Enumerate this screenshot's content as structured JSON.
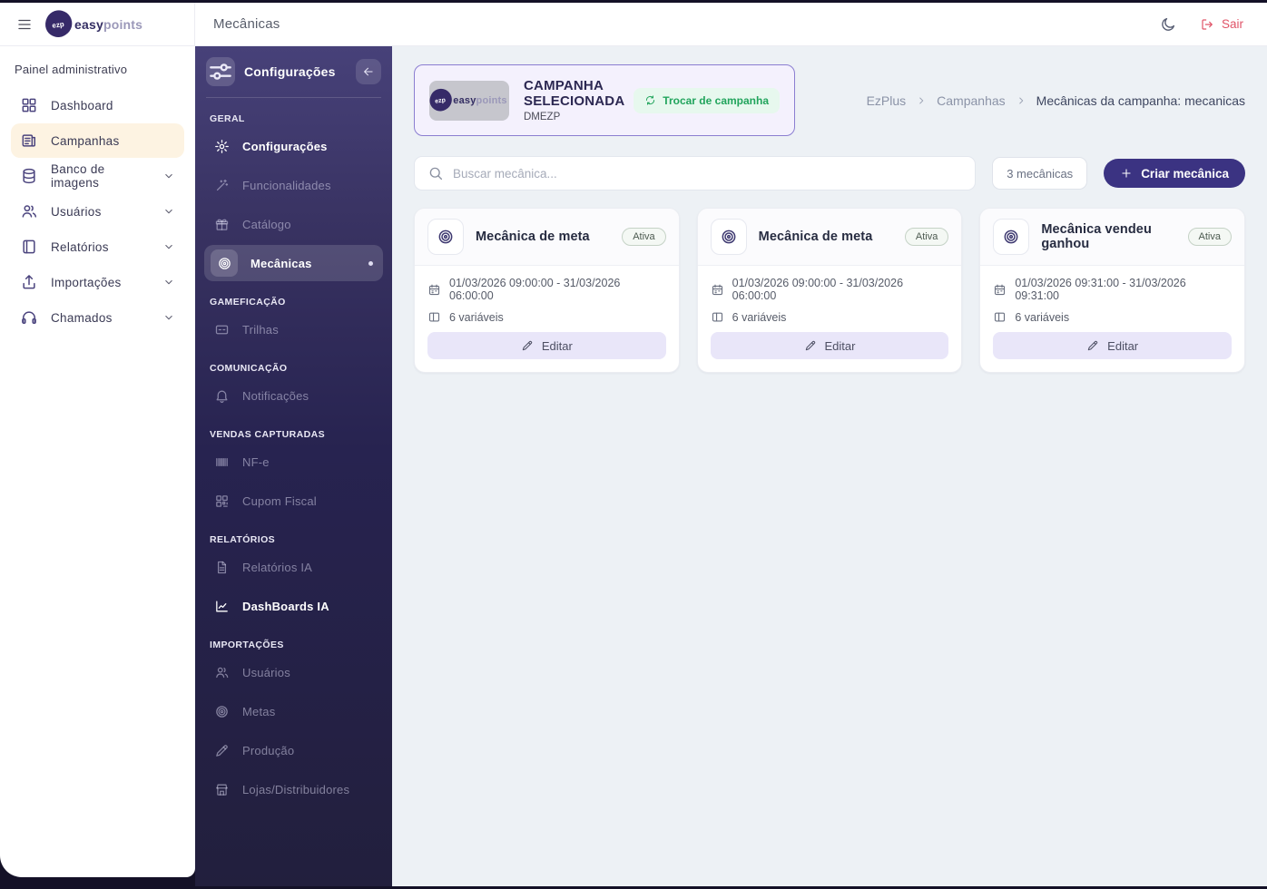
{
  "brand": {
    "mark": "ezp",
    "name_bold": "easy",
    "name_light": "points"
  },
  "topbar": {
    "title": "Mecânicas",
    "logout_label": "Sair",
    "icons": {
      "menu": "hamburger-icon",
      "theme": "moon-icon",
      "logout": "logout-icon"
    }
  },
  "outer_sidebar": {
    "heading": "Painel administrativo",
    "items": [
      {
        "label": "Dashboard",
        "icon": "grid",
        "active": false,
        "chevron": false
      },
      {
        "label": "Campanhas",
        "icon": "newspaper",
        "active": true,
        "chevron": false
      },
      {
        "label": "Banco de imagens",
        "icon": "database",
        "active": false,
        "chevron": true
      },
      {
        "label": "Usuários",
        "icon": "users",
        "active": false,
        "chevron": true
      },
      {
        "label": "Relatórios",
        "icon": "book",
        "active": false,
        "chevron": true
      },
      {
        "label": "Importações",
        "icon": "upload",
        "active": false,
        "chevron": true
      },
      {
        "label": "Chamados",
        "icon": "headset",
        "active": false,
        "chevron": true
      }
    ]
  },
  "inner_sidebar": {
    "title": "Configurações",
    "header_icon": "sliders",
    "collapse_icon": "arrow-left",
    "sections": [
      {
        "label": "GERAL",
        "items": [
          {
            "label": "Configurações",
            "icon": "gear",
            "state": "bright"
          },
          {
            "label": "Funcionalidades",
            "icon": "wand",
            "state": "dim"
          },
          {
            "label": "Catálogo",
            "icon": "gift",
            "state": "dim"
          },
          {
            "label": "Mecânicas",
            "icon": "target",
            "state": "active"
          }
        ]
      },
      {
        "label": "GAMEFICAÇÃO",
        "items": [
          {
            "label": "Trilhas",
            "icon": "card",
            "state": "dim"
          }
        ]
      },
      {
        "label": "COMUNICAÇÃO",
        "items": [
          {
            "label": "Notificações",
            "icon": "bell",
            "state": "dim"
          }
        ]
      },
      {
        "label": "VENDAS CAPTURADAS",
        "items": [
          {
            "label": "NF-e",
            "icon": "barcode",
            "state": "dim"
          },
          {
            "label": "Cupom Fiscal",
            "icon": "qrcode",
            "state": "dim"
          }
        ]
      },
      {
        "label": "RELATÓRIOS",
        "items": [
          {
            "label": "Relatórios IA",
            "icon": "file",
            "state": "dim"
          },
          {
            "label": "DashBoards IA",
            "icon": "chart",
            "state": "bright"
          }
        ]
      },
      {
        "label": "IMPORTAÇÕES",
        "items": [
          {
            "label": "Usuários",
            "icon": "users",
            "state": "dim"
          },
          {
            "label": "Metas",
            "icon": "target",
            "state": "dim"
          },
          {
            "label": "Produção",
            "icon": "pencil",
            "state": "dim"
          },
          {
            "label": "Lojas/Distribuidores",
            "icon": "store",
            "state": "dim"
          }
        ]
      }
    ]
  },
  "campaign_banner": {
    "title": "CAMPANHA SELECIONADA",
    "subtitle": "DMEZP",
    "change_button": "Trocar de campanha"
  },
  "breadcrumb": {
    "items": [
      "EzPlus",
      "Campanhas",
      "Mecânicas da campanha: mecanicas"
    ]
  },
  "toolbar": {
    "search_placeholder": "Buscar mecânica...",
    "count_badge": "3 mecânicas",
    "create_button": "Criar mecânica"
  },
  "cards": [
    {
      "title": "Mecânica de meta",
      "status": "Ativa",
      "date_range": "01/03/2026 09:00:00 - 31/03/2026 06:00:00",
      "variables": "6 variáveis",
      "edit_label": "Editar"
    },
    {
      "title": "Mecânica de meta",
      "status": "Ativa",
      "date_range": "01/03/2026 09:00:00 - 31/03/2026 06:00:00",
      "variables": "6 variáveis",
      "edit_label": "Editar"
    },
    {
      "title": "Mecânica vendeu ganhou",
      "status": "Ativa",
      "date_range": "01/03/2026 09:31:00 - 31/03/2026 09:31:00",
      "variables": "6 variáveis",
      "edit_label": "Editar"
    }
  ],
  "colors": {
    "sidebar_gradient_top": "#474179",
    "sidebar_gradient_bottom": "#221f3d",
    "active_nav_cream": "#fdf3e2",
    "accent_purple": "#3b3382",
    "banner_border": "#8b7ed1",
    "banner_bg": "#f4f1fd",
    "green_action": "#21a45c",
    "logout_red": "#e05468",
    "main_bg": "#edf1f5",
    "status_pill_border": "#c5d2c6"
  }
}
